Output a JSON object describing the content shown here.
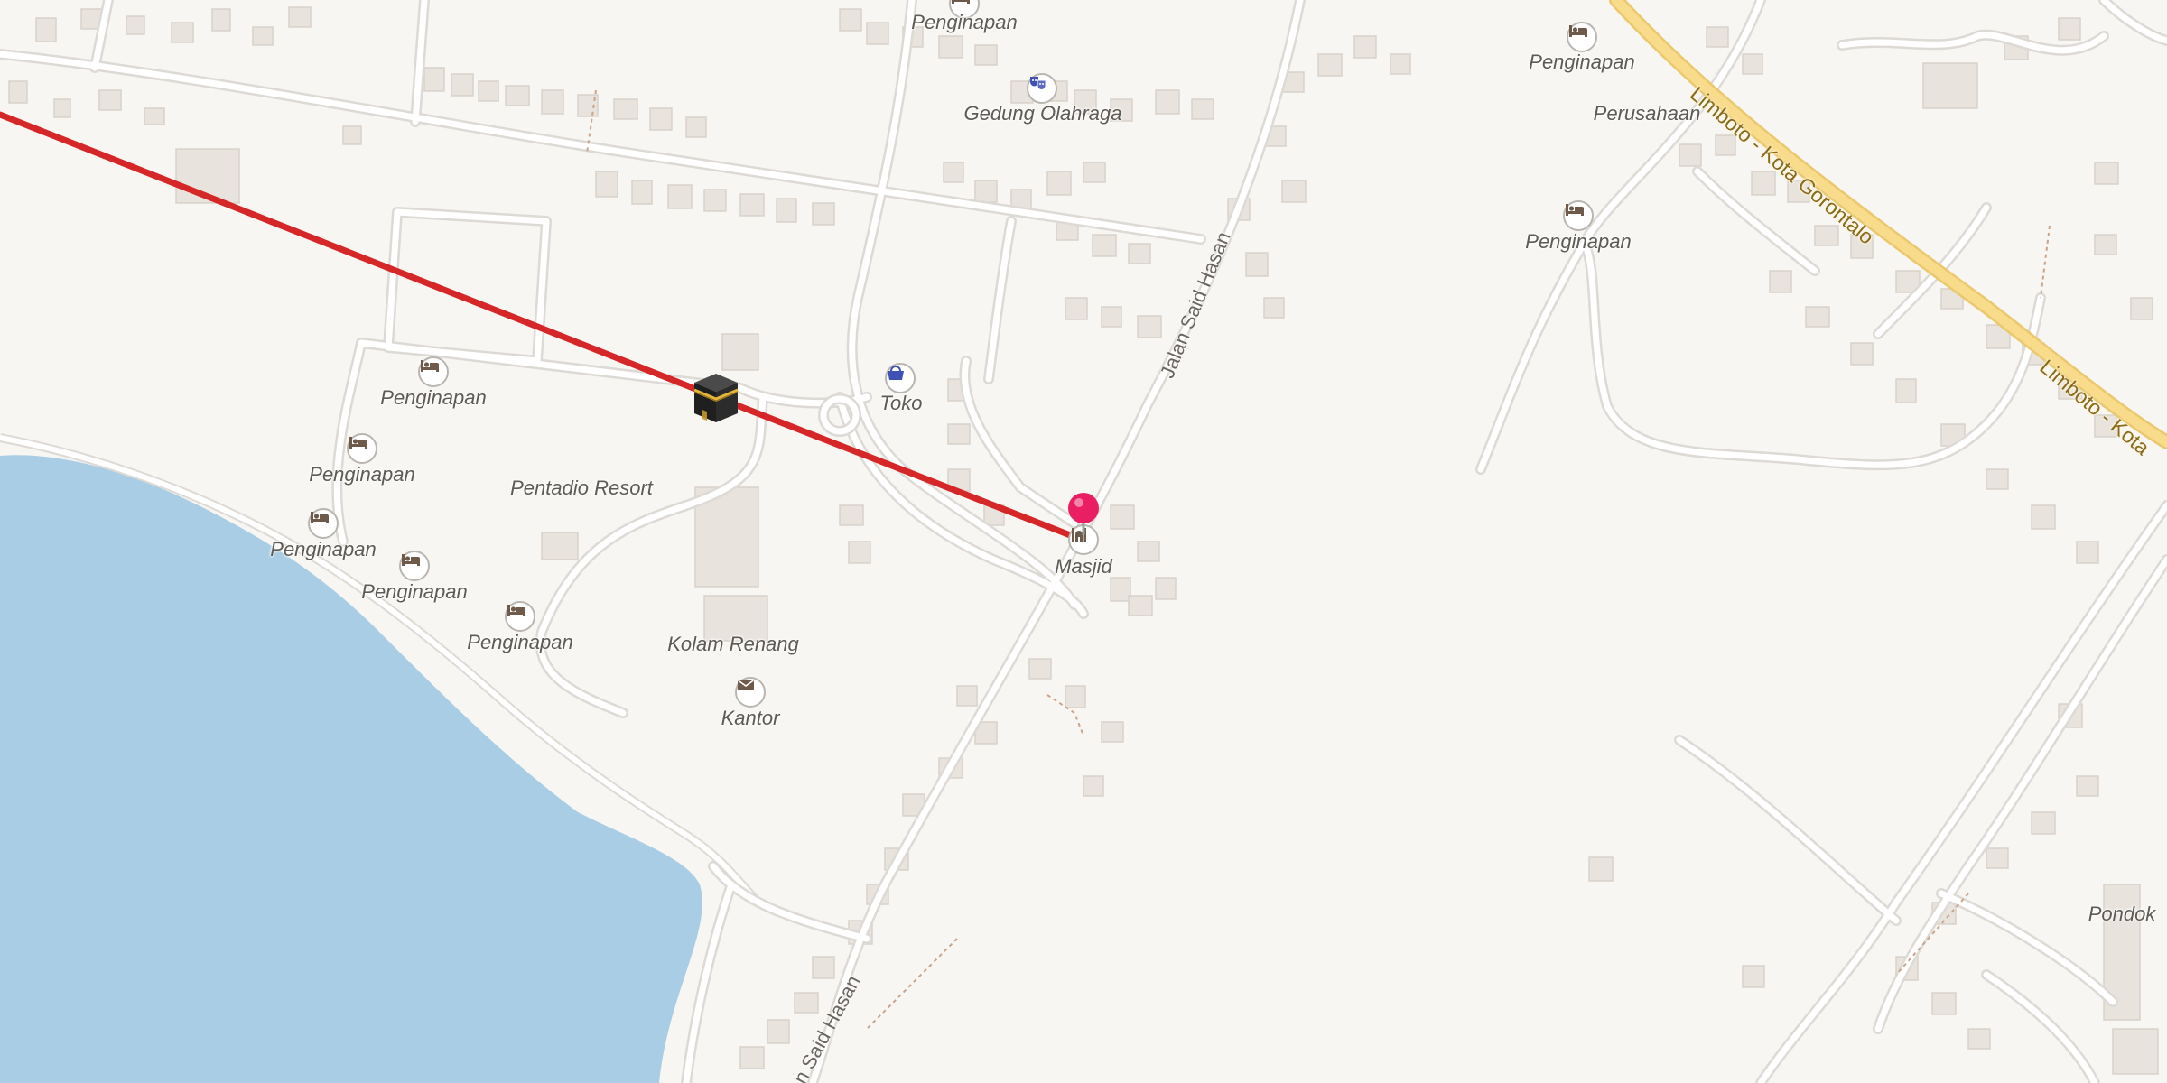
{
  "map": {
    "colors": {
      "land": "#f8f6f3",
      "water": "#a9cde4",
      "road": "#ffffff",
      "road_casing": "#dddad5",
      "primary_road": "#f9db8c",
      "primary_casing": "#e9c86e",
      "building": "#e8e3dc",
      "building_edge": "#d8d2ca",
      "route_line": "#d62728",
      "pin": "#e91e63",
      "poi_icon": "#6d5a4b",
      "poi_icon_blue": "#3f51b5"
    },
    "route": {
      "label": ""
    },
    "pois": [
      {
        "label": "Penginapan",
        "icon": "bed-icon"
      },
      {
        "label": "Gedung Olahraga",
        "icon": "theatre-masks-icon"
      },
      {
        "label": "Penginapan",
        "icon": "bed-icon"
      },
      {
        "label": "Perusahaan",
        "icon": ""
      },
      {
        "label": "Penginapan",
        "icon": "bed-icon"
      },
      {
        "label": "Penginapan",
        "icon": "bed-icon"
      },
      {
        "label": "Toko",
        "icon": "shopping-basket-icon"
      },
      {
        "label": "Penginapan",
        "icon": "bed-icon"
      },
      {
        "label": "Pentadio Resort",
        "icon": ""
      },
      {
        "label": "Penginapan",
        "icon": "bed-icon"
      },
      {
        "label": "Masjid",
        "icon": "mosque-icon"
      },
      {
        "label": "Penginapan",
        "icon": "bed-icon"
      },
      {
        "label": "Penginapan",
        "icon": "bed-icon"
      },
      {
        "label": "Kolam Renang",
        "icon": ""
      },
      {
        "label": "Kantor",
        "icon": "envelope-icon"
      },
      {
        "label": "Pondok",
        "icon": ""
      }
    ],
    "roads": {
      "jalan_said_hasan": "Jalan Said Hasan",
      "jalan_said_hasan_bottom": "n Said Hasan",
      "limboto_1": "Limboto - Kota Gorontalo",
      "limboto_2": "Limboto - Kota"
    },
    "markers": {
      "kaaba": "kaaba-icon",
      "pin": "location-pin-icon"
    }
  }
}
